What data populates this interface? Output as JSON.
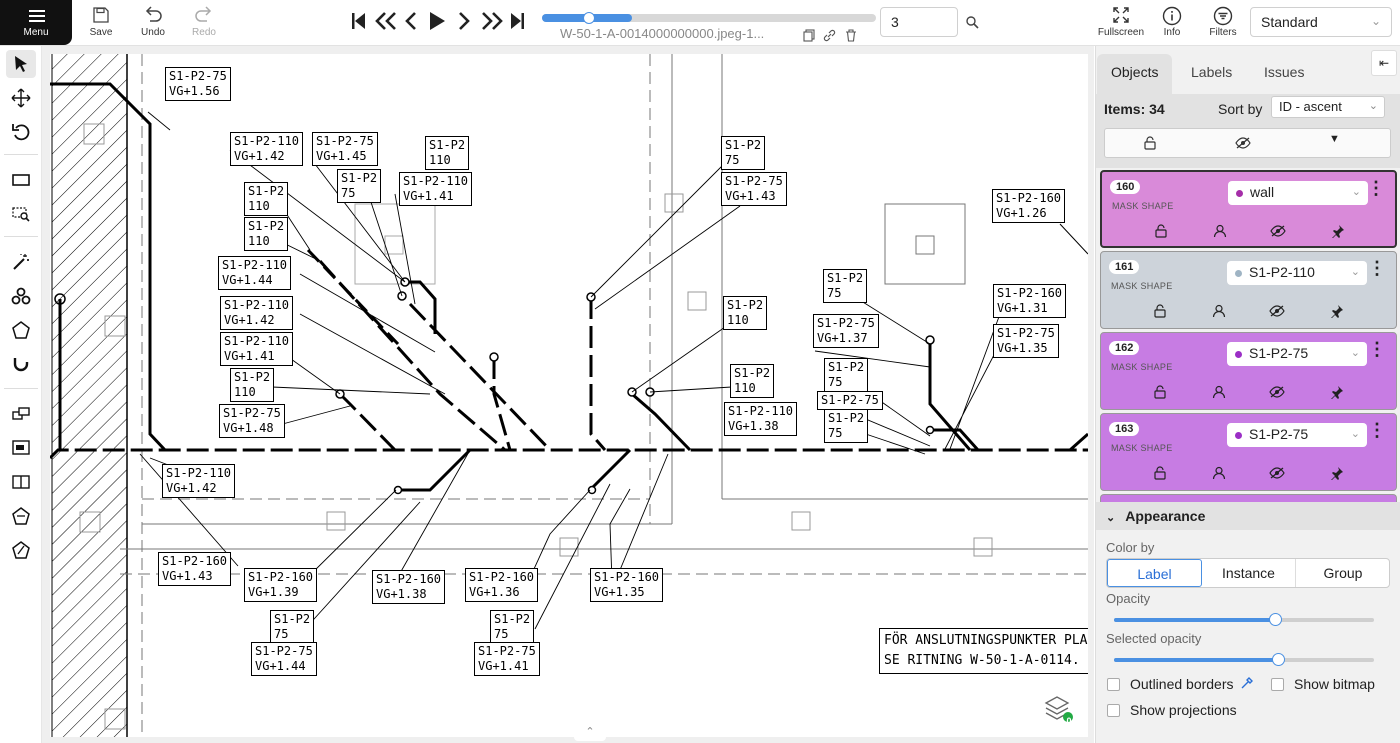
{
  "toolbar": {
    "menu_label": "Menu",
    "save_label": "Save",
    "undo_label": "Undo",
    "redo_label": "Redo",
    "filename": "W-50-1-A-0014000000000.jpeg-1...",
    "frame_value": "3",
    "fullscreen_label": "Fullscreen",
    "info_label": "Info",
    "filters_label": "Filters",
    "workspace": "Standard",
    "player_progress_percent": 14
  },
  "drawing": {
    "labels": [
      [
        "S1-P2-75",
        "VG+1.56"
      ],
      [
        "S1-P2-110",
        "VG+1.42"
      ],
      [
        "S1-P2-75",
        "VG+1.45"
      ],
      [
        "S1-P2",
        "110"
      ],
      [
        "S1-P2",
        "75"
      ],
      [
        "S1-P2-110",
        "VG+1.41"
      ],
      [
        "S1-P2",
        "110"
      ],
      [
        "S1-P2",
        "110"
      ],
      [
        "S1-P2-110",
        "VG+1.44"
      ],
      [
        "S1-P2-110",
        "VG+1.42"
      ],
      [
        "S1-P2-110",
        "VG+1.41"
      ],
      [
        "S1-P2",
        "110"
      ],
      [
        "S1-P2-75",
        "VG+1.48"
      ],
      [
        "S1-P2-110",
        "VG+1.42"
      ],
      [
        "S1-P2-160",
        "VG+1.43"
      ],
      [
        "S1-P2-160",
        "VG+1.39"
      ],
      [
        "S1-P2",
        "75"
      ],
      [
        "S1-P2-75",
        "VG+1.44"
      ],
      [
        "S1-P2-160",
        "VG+1.38"
      ],
      [
        "S1-P2-160",
        "VG+1.36"
      ],
      [
        "S1-P2",
        "75"
      ],
      [
        "S1-P2-75",
        "VG+1.41"
      ],
      [
        "S1-P2-160",
        "VG+1.35"
      ],
      [
        "S1-P2",
        "75"
      ],
      [
        "S1-P2-75",
        "VG+1.43"
      ],
      [
        "S1-P2",
        "110"
      ],
      [
        "S1-P2",
        "110"
      ],
      [
        "S1-P2-110",
        "VG+1.38"
      ],
      [
        "S1-P2",
        "75"
      ],
      [
        "S1-P2-75",
        "VG+1.37"
      ],
      [
        "S1-P2",
        "75"
      ],
      [
        "S1-P2-75",
        ""
      ],
      [
        "S1-P2",
        "75"
      ],
      [
        "S1-P2-160",
        "VG+1.26"
      ],
      [
        "S1-P2-160",
        "VG+1.31"
      ],
      [
        "S1-P2-75",
        "VG+1.35"
      ]
    ],
    "note": [
      "FÖR ANSLUTNINGSPUNKTER PLAN",
      "SE RITNING W-50-1-A-0114."
    ],
    "layers_badge": "0"
  },
  "panel": {
    "tabs": [
      "Objects",
      "Labels",
      "Issues"
    ],
    "items_label": "Items: 34",
    "sort_label": "Sort by",
    "sort_value": "ID - ascent",
    "cards": [
      {
        "id": "160",
        "kind": "MASK SHAPE",
        "label": "wall",
        "color": "#c95ad0",
        "bg": "#d98ad9",
        "dot": "#a52ea8",
        "selected": true
      },
      {
        "id": "161",
        "kind": "MASK SHAPE",
        "label": "S1-P2-110",
        "color": "#c7ced6",
        "bg": "#cdd3da",
        "dot": "#9fb4c4",
        "selected": false
      },
      {
        "id": "162",
        "kind": "MASK SHAPE",
        "label": "S1-P2-75",
        "color": "#c065e0",
        "bg": "#c77ce3",
        "dot": "#9b2fc6",
        "selected": false
      },
      {
        "id": "163",
        "kind": "MASK SHAPE",
        "label": "S1-P2-75",
        "color": "#c065e0",
        "bg": "#c77ce3",
        "dot": "#9b2fc6",
        "selected": false
      }
    ],
    "appearance": {
      "title": "Appearance",
      "color_by_label": "Color by",
      "color_by_options": [
        "Label",
        "Instance",
        "Group"
      ],
      "color_by_selected": "Label",
      "opacity_label": "Opacity",
      "opacity_value": 0.62,
      "selected_opacity_label": "Selected opacity",
      "selected_opacity_value": 0.62,
      "outlined_borders_label": "Outlined borders",
      "show_bitmap_label": "Show bitmap",
      "show_projections_label": "Show projections"
    }
  }
}
